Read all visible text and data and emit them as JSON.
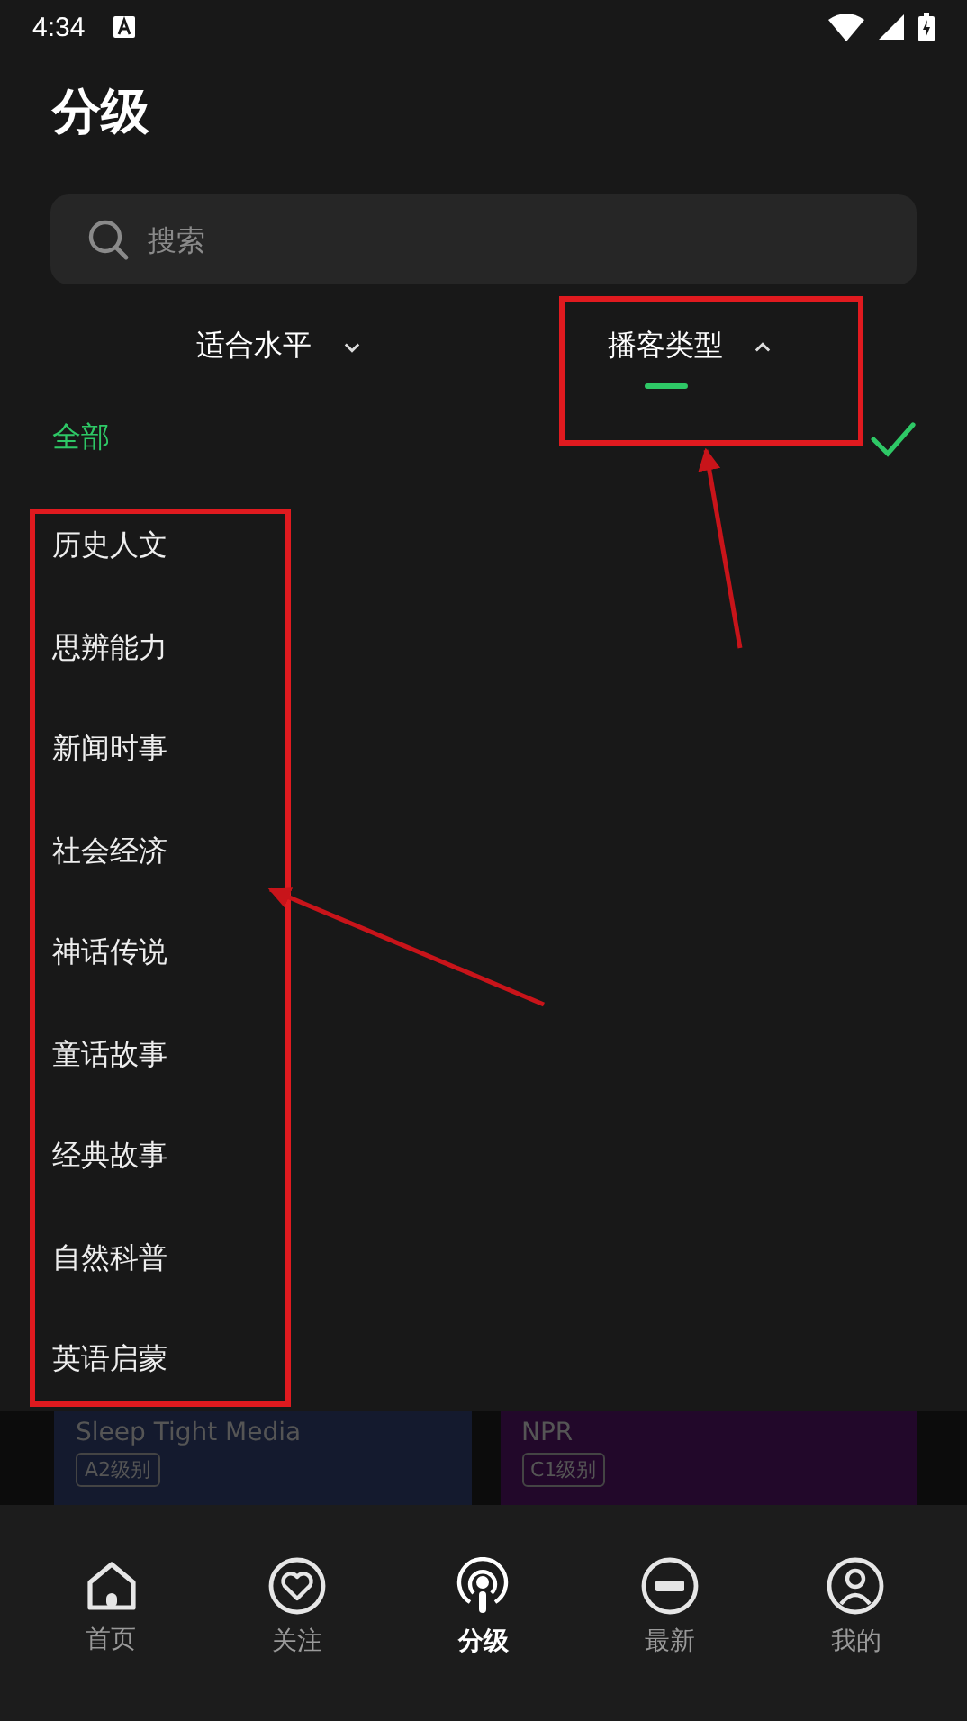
{
  "status_bar": {
    "time": "4:34"
  },
  "title": "分级",
  "search": {
    "placeholder": "搜索"
  },
  "filters": [
    {
      "label": "适合水平",
      "selected": false
    },
    {
      "label": "播客类型",
      "selected": true
    }
  ],
  "options": [
    {
      "label": "全部",
      "selected": true
    },
    {
      "label": "历史人文",
      "selected": false
    },
    {
      "label": "思辨能力",
      "selected": false
    },
    {
      "label": "新闻时事",
      "selected": false
    },
    {
      "label": "社会经济",
      "selected": false
    },
    {
      "label": "神话传说",
      "selected": false
    },
    {
      "label": "童话故事",
      "selected": false
    },
    {
      "label": "经典故事",
      "selected": false
    },
    {
      "label": "自然科普",
      "selected": false
    },
    {
      "label": "英语启蒙",
      "selected": false
    }
  ],
  "cards": [
    {
      "title": "Sleep Tight Media",
      "level": "A2级别",
      "color": "#141a2e"
    },
    {
      "title": "NPR",
      "level": "C1级别",
      "color": "#22082a"
    }
  ],
  "nav": [
    {
      "label": "首页",
      "kind": "home",
      "selected": false
    },
    {
      "label": "关注",
      "kind": "heart",
      "selected": false
    },
    {
      "label": "分级",
      "kind": "podcast",
      "selected": true
    },
    {
      "label": "最新",
      "kind": "new",
      "selected": false
    },
    {
      "label": "我的",
      "kind": "user",
      "selected": false
    }
  ]
}
